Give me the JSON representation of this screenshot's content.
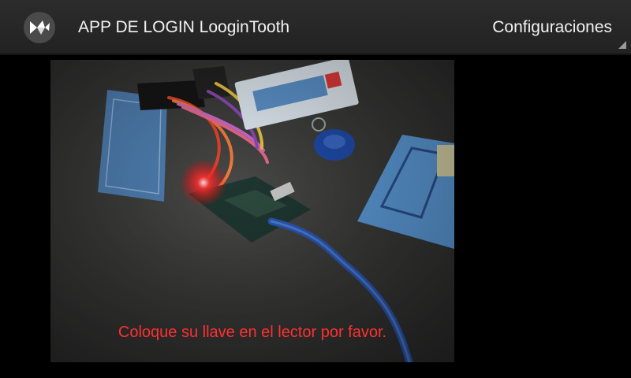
{
  "action_bar": {
    "app_icon": "kivy-logo-icon",
    "title": "APP DE LOGIN LooginTooth",
    "menu_label": "Configuraciones"
  },
  "preview": {
    "status_message": "Coloque su llave en el lector por favor.",
    "status_color": "#ff3030"
  }
}
